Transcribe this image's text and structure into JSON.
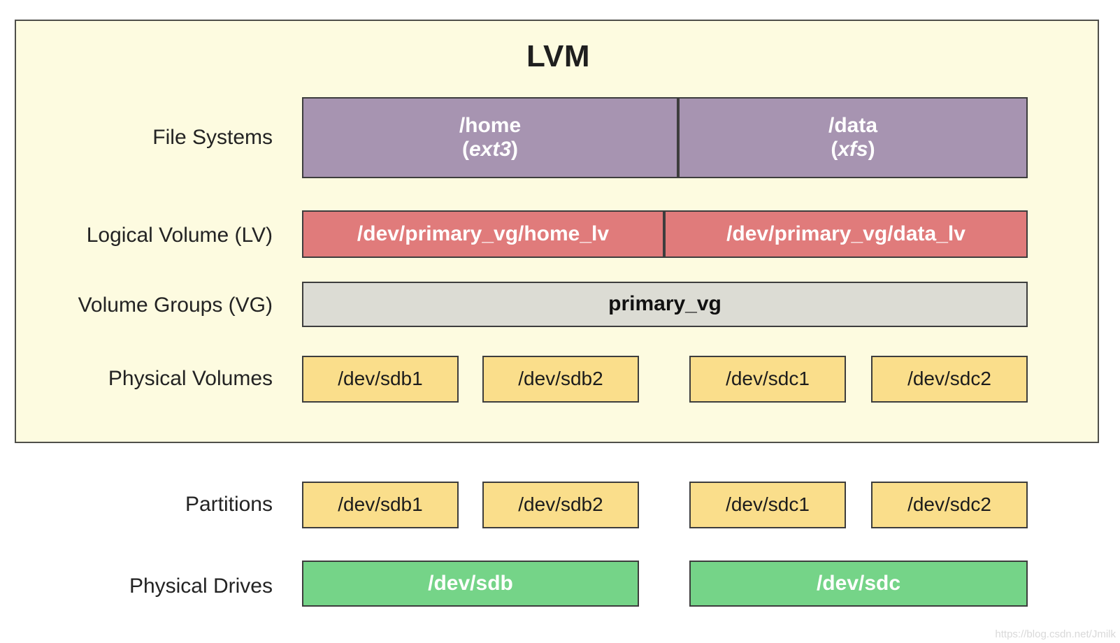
{
  "diagram": {
    "title": "LVM",
    "watermark": "https://blog.csdn.net/Jmilk"
  },
  "rows": {
    "file_systems": {
      "label": "File Systems",
      "items": [
        {
          "name": "/home",
          "type": "ext3",
          "type_display": "(ext3)"
        },
        {
          "name": "/data",
          "type": "xfs",
          "type_display": "(xfs)"
        }
      ]
    },
    "logical_volume": {
      "label": "Logical Volume (LV)",
      "items": [
        {
          "name": "/dev/primary_vg/home_lv"
        },
        {
          "name": "/dev/primary_vg/data_lv"
        }
      ]
    },
    "volume_groups": {
      "label": "Volume Groups (VG)",
      "items": [
        {
          "name": "primary_vg"
        }
      ]
    },
    "physical_volumes": {
      "label": "Physical Volumes",
      "items": [
        {
          "name": "/dev/sdb1"
        },
        {
          "name": "/dev/sdb2"
        },
        {
          "name": "/dev/sdc1"
        },
        {
          "name": "/dev/sdc2"
        }
      ]
    },
    "partitions": {
      "label": "Partitions",
      "items": [
        {
          "name": "/dev/sdb1"
        },
        {
          "name": "/dev/sdb2"
        },
        {
          "name": "/dev/sdc1"
        },
        {
          "name": "/dev/sdc2"
        }
      ]
    },
    "physical_drives": {
      "label": "Physical Drives",
      "items": [
        {
          "name": "/dev/sdb"
        },
        {
          "name": "/dev/sdc"
        }
      ]
    }
  },
  "colors": {
    "container_bg": "#fdfbe0",
    "file_system": "#a794b1",
    "logical_volume": "#e07b7b",
    "volume_group": "#dcdcd4",
    "physical_volume": "#fade8b",
    "physical_drive": "#75d488",
    "border": "#3d3d3d",
    "page_bg": "#ffffff"
  }
}
